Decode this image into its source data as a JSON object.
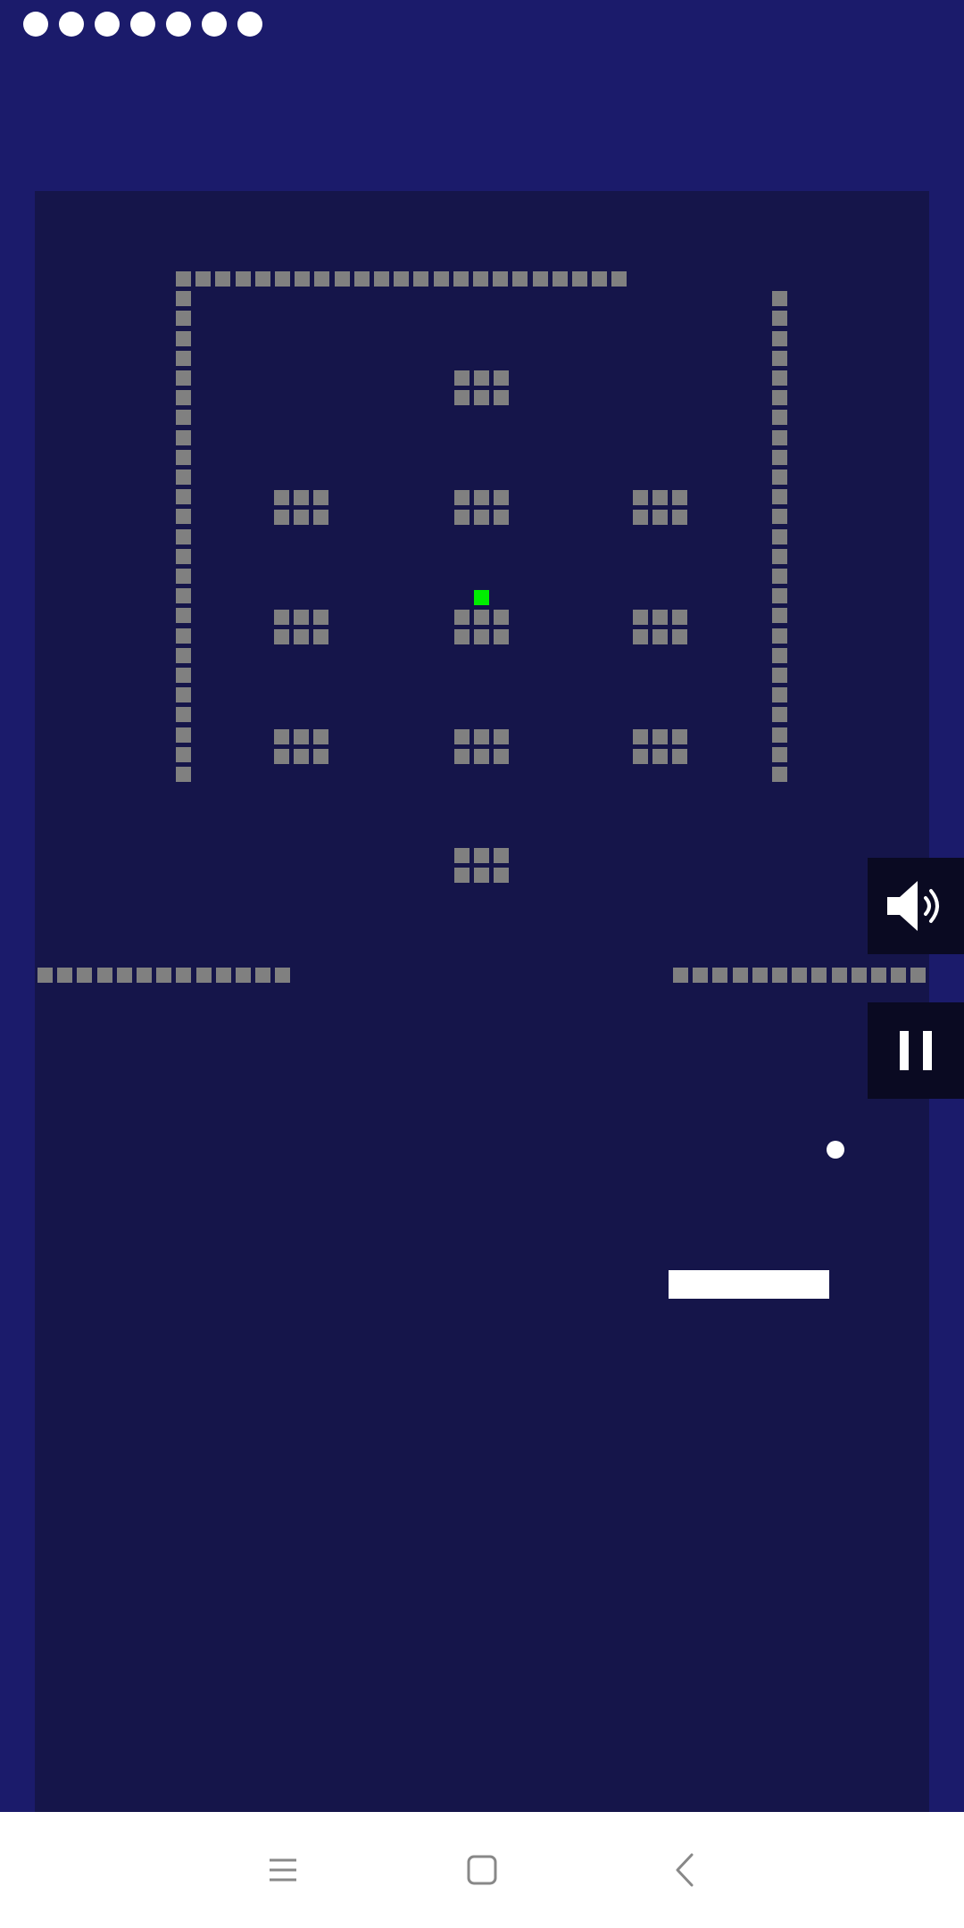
{
  "game": {
    "lives": 7,
    "colors": {
      "background": "#1b1b6b",
      "playfield": "#15154a",
      "brick": "#808080",
      "special_brick": "#00ee00",
      "ball": "#ffffff",
      "paddle": "#ffffff",
      "control_button": "#0a0a22",
      "nav_bar": "#ffffff",
      "nav_icon": "#888888"
    }
  },
  "controls": {
    "sound_icon": "speaker-icon",
    "pause_icon": "pause-icon"
  },
  "navigation": {
    "menu_icon": "menu-icon",
    "home_icon": "home-icon",
    "back_icon": "back-icon"
  }
}
